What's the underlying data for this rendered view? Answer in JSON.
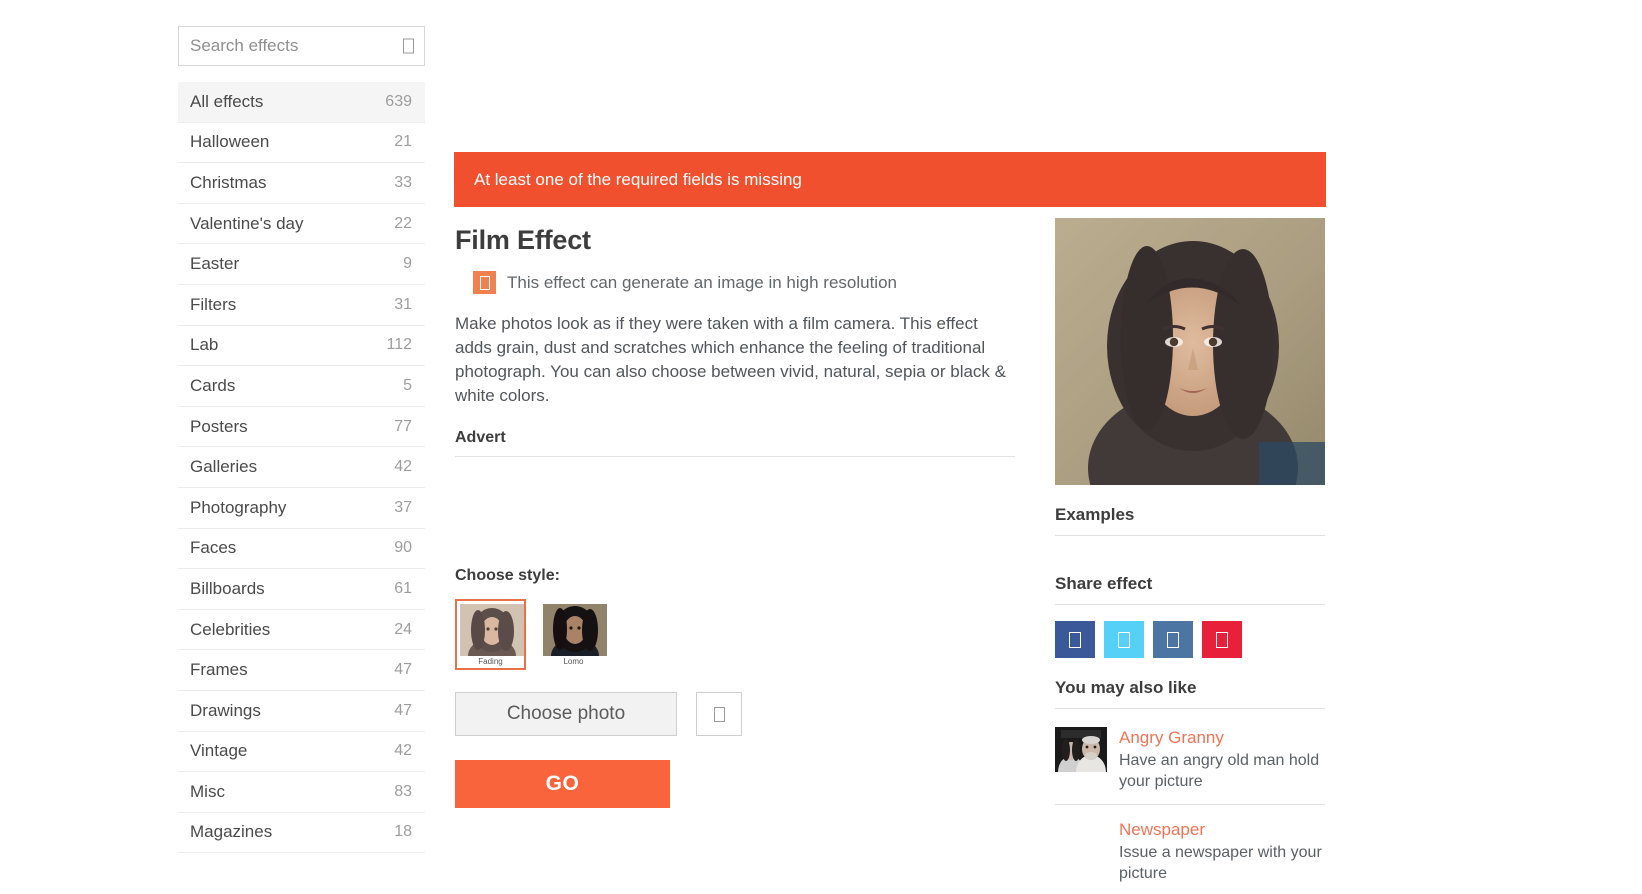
{
  "search": {
    "placeholder": "Search effects",
    "value": "",
    "icon": "search-icon"
  },
  "sidebar": {
    "items": [
      {
        "label": "All effects",
        "count": "639",
        "active": true
      },
      {
        "label": "Halloween",
        "count": "21",
        "active": false
      },
      {
        "label": "Christmas",
        "count": "33",
        "active": false
      },
      {
        "label": "Valentine's day",
        "count": "22",
        "active": false
      },
      {
        "label": "Easter",
        "count": "9",
        "active": false
      },
      {
        "label": "Filters",
        "count": "31",
        "active": false
      },
      {
        "label": "Lab",
        "count": "112",
        "active": false
      },
      {
        "label": "Cards",
        "count": "5",
        "active": false
      },
      {
        "label": "Posters",
        "count": "77",
        "active": false
      },
      {
        "label": "Galleries",
        "count": "42",
        "active": false
      },
      {
        "label": "Photography",
        "count": "37",
        "active": false
      },
      {
        "label": "Faces",
        "count": "90",
        "active": false
      },
      {
        "label": "Billboards",
        "count": "61",
        "active": false
      },
      {
        "label": "Celebrities",
        "count": "24",
        "active": false
      },
      {
        "label": "Frames",
        "count": "47",
        "active": false
      },
      {
        "label": "Drawings",
        "count": "47",
        "active": false
      },
      {
        "label": "Vintage",
        "count": "42",
        "active": false
      },
      {
        "label": "Misc",
        "count": "83",
        "active": false
      },
      {
        "label": "Magazines",
        "count": "18",
        "active": false
      }
    ]
  },
  "alert": {
    "message": "At least one of the required fields is missing",
    "color": "#f1502f"
  },
  "effect": {
    "title": "Film Effect",
    "hires_note": "This effect can generate an image in high resolution",
    "hires_badge_icon": "high-resolution-icon",
    "description": "Make photos look as if they were taken with a film camera. This effect adds grain, dust and scratches which enhance the feeling of traditional photograph. You can also choose between vivid, natural, sepia or black & white colors."
  },
  "advert": {
    "heading": "Advert"
  },
  "style_picker": {
    "label": "Choose style:",
    "options": [
      {
        "caption": "Fading",
        "selected": true
      },
      {
        "caption": "Lomo",
        "selected": false
      }
    ]
  },
  "form": {
    "choose_photo_label": "Choose photo",
    "upload_icon": "upload-icon",
    "go_label": "GO",
    "go_color": "#f9643d"
  },
  "right": {
    "examples_heading": "Examples",
    "share_heading": "Share effect",
    "share_buttons": [
      {
        "name": "facebook",
        "color": "#3b5998",
        "icon": "facebook-icon"
      },
      {
        "name": "twitter",
        "color": "#55d0f7",
        "icon": "twitter-icon"
      },
      {
        "name": "vk",
        "color": "#4c75a3",
        "icon": "vk-icon"
      },
      {
        "name": "pinterest",
        "color": "#e8203a",
        "icon": "pinterest-icon"
      }
    ],
    "related_heading": "You may also like",
    "related": [
      {
        "title": "Angry Granny",
        "desc": "Have an angry old man hold your picture",
        "has_thumb": true
      },
      {
        "title": "Newspaper",
        "desc": "Issue a newspaper with your picture",
        "has_thumb": false
      }
    ]
  }
}
